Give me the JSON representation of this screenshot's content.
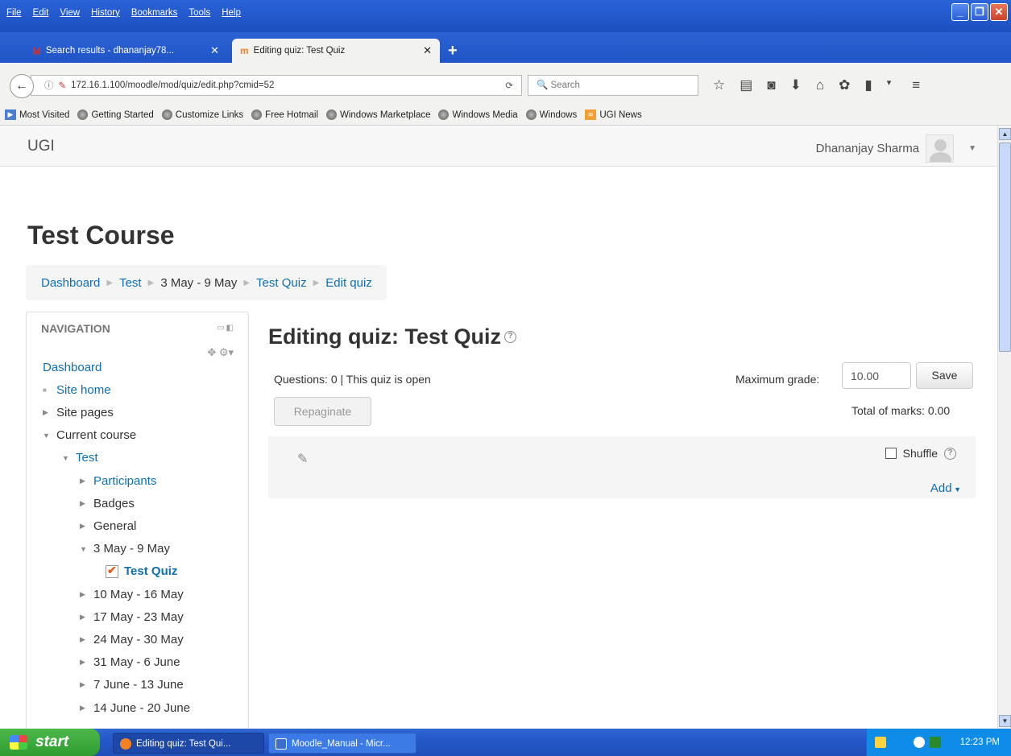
{
  "browser": {
    "menu": [
      "File",
      "Edit",
      "View",
      "History",
      "Bookmarks",
      "Tools",
      "Help"
    ],
    "tabs": [
      {
        "label": "Search results - dhananjay78...",
        "icon": "gmail-icon"
      },
      {
        "label": "Editing quiz: Test Quiz",
        "icon": "moodle-icon"
      }
    ],
    "url": "172.16.1.100/moodle/mod/quiz/edit.php?cmid=52",
    "search_placeholder": "Search",
    "bookmarks": [
      "Most Visited",
      "Getting Started",
      "Customize Links",
      "Free Hotmail",
      "Windows Marketplace",
      "Windows Media",
      "Windows",
      "UGI News"
    ]
  },
  "site": {
    "brand": "UGI",
    "user_name": "Dhananjay Sharma"
  },
  "course": {
    "title": "Test Course",
    "breadcrumb": [
      "Dashboard",
      "Test",
      "3 May - 9 May",
      "Test Quiz",
      "Edit quiz"
    ]
  },
  "navigation": {
    "title": "NAVIGATION",
    "items": [
      {
        "label": "Dashboard",
        "type": "link",
        "level": 0,
        "marker": "none"
      },
      {
        "label": "Site home",
        "type": "link",
        "level": 0,
        "marker": "bullet"
      },
      {
        "label": "Site pages",
        "type": "plain",
        "level": 0,
        "marker": "collapsed"
      },
      {
        "label": "Current course",
        "type": "plain",
        "level": 0,
        "marker": "expanded"
      },
      {
        "label": "Test",
        "type": "link",
        "level": 1,
        "marker": "expanded"
      },
      {
        "label": "Participants",
        "type": "link",
        "level": 2,
        "marker": "collapsed"
      },
      {
        "label": "Badges",
        "type": "plain",
        "level": 2,
        "marker": "collapsed"
      },
      {
        "label": "General",
        "type": "plain",
        "level": 2,
        "marker": "collapsed"
      },
      {
        "label": "3 May - 9 May",
        "type": "plain",
        "level": 2,
        "marker": "expanded"
      },
      {
        "label": "Test Quiz",
        "type": "link-bold",
        "level": 3,
        "marker": "quiz"
      },
      {
        "label": "10 May - 16 May",
        "type": "plain",
        "level": 2,
        "marker": "collapsed"
      },
      {
        "label": "17 May - 23 May",
        "type": "plain",
        "level": 2,
        "marker": "collapsed"
      },
      {
        "label": "24 May - 30 May",
        "type": "plain",
        "level": 2,
        "marker": "collapsed"
      },
      {
        "label": "31 May - 6 June",
        "type": "plain",
        "level": 2,
        "marker": "collapsed"
      },
      {
        "label": "7 June - 13 June",
        "type": "plain",
        "level": 2,
        "marker": "collapsed"
      },
      {
        "label": "14 June - 20 June",
        "type": "plain",
        "level": 2,
        "marker": "collapsed"
      }
    ]
  },
  "quiz": {
    "heading": "Editing quiz: Test Quiz",
    "status": "Questions: 0 | This quiz is open",
    "max_grade_label": "Maximum grade:",
    "max_grade_value": "10.00",
    "save_label": "Save",
    "repaginate_label": "Repaginate",
    "total_marks": "Total of marks: 0.00",
    "shuffle_label": "Shuffle",
    "add_label": "Add"
  },
  "taskbar": {
    "start_label": "start",
    "tasks": [
      "Editing quiz: Test Qui...",
      "Moodle_Manual - Micr..."
    ],
    "clock": "12:23 PM"
  },
  "colors": {
    "link": "#0f6fb1",
    "xp_blue": "#2457c8",
    "start_green": "#3aa83a"
  }
}
